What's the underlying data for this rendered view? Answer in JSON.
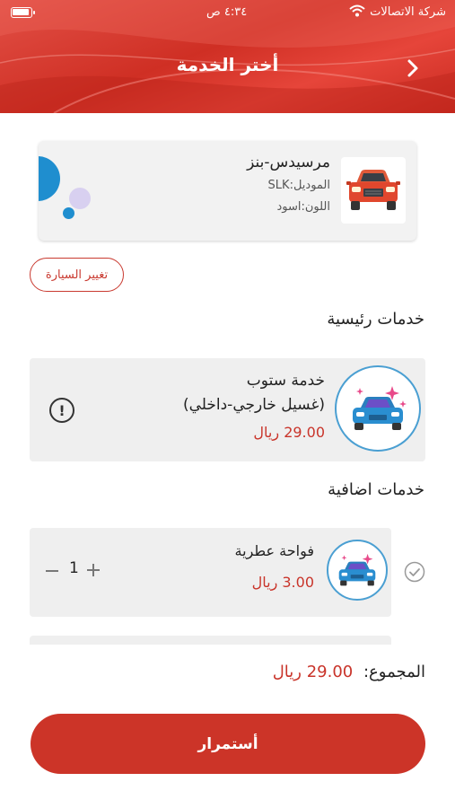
{
  "status_bar": {
    "carrier": "شركة الاتصالات",
    "time": "٤:٣٤ ص"
  },
  "header": {
    "title": "أختر الخدمة",
    "back_icon": "chevron-icon"
  },
  "car": {
    "brand": "مرسيدس-بنز",
    "model": "الموديل:SLK",
    "color": "اللون:اسود",
    "change_label": "تغيير السيارة"
  },
  "main_services": {
    "title": "خدمات رئيسية",
    "items": [
      {
        "name_line1": "خدمة ستوب",
        "name_line2": "(غسيل خارجي-داخلي)",
        "price": "29.00 ريال",
        "info_icon": "!"
      }
    ]
  },
  "extra_services": {
    "title": "خدمات اضافية",
    "items": [
      {
        "name": "فواحة عطرية",
        "price": "3.00 ريال",
        "quantity": "1"
      }
    ]
  },
  "total": {
    "label": "المجموع:",
    "value": "29.00 ريال"
  },
  "continue_label": "أستمرار",
  "colors": {
    "primary": "#cc3428",
    "price": "#c9342a",
    "card": "#efefef"
  }
}
